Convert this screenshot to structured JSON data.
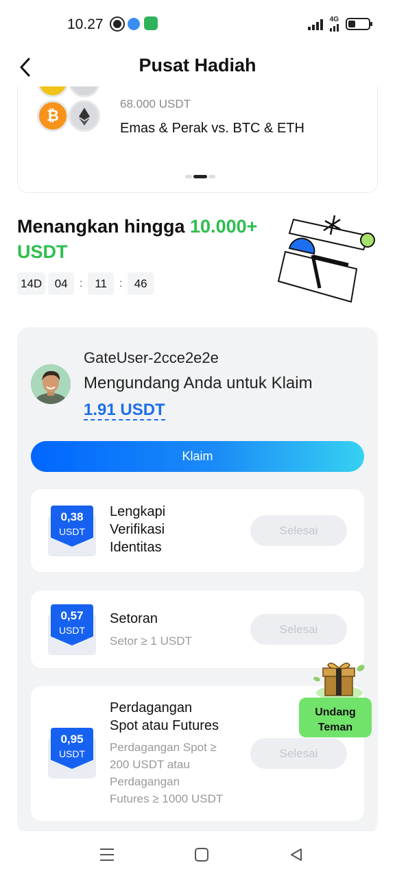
{
  "status_bar": {
    "time": "10.27",
    "network": "4G"
  },
  "header": {
    "title": "Pusat Hadiah"
  },
  "carousel": {
    "subtitle": "68.000 USDT",
    "title": "Emas & Perak vs. BTC & ETH"
  },
  "promo": {
    "headline_prefix": "Menangkan hingga ",
    "headline_amount": "10.000+",
    "headline_suffix": "USDT",
    "countdown": {
      "days": "14D",
      "hours": "04",
      "minutes": "11",
      "seconds": "46",
      "separator": ":"
    }
  },
  "invite": {
    "inviter_name": "GateUser-2cce2e2e",
    "message": "Mengundang Anda untuk Klaim",
    "amount": "1.91 USDT",
    "claim_label": "Klaim"
  },
  "tasks": [
    {
      "reward_value": "0,38",
      "reward_unit": "USDT",
      "title_lines": [
        "Lengkapi",
        "Verifikasi",
        "Identitas"
      ],
      "desc_lines": [],
      "status_label": "Selesai"
    },
    {
      "reward_value": "0,57",
      "reward_unit": "USDT",
      "title_lines": [
        "Setoran"
      ],
      "desc_lines": [
        "Setor ≥ 1 USDT"
      ],
      "status_label": "Selesai"
    },
    {
      "reward_value": "0,95",
      "reward_unit": "USDT",
      "title_lines": [
        "Perdagangan",
        "Spot atau Futures"
      ],
      "desc_lines": [
        "Perdagangan Spot ≥",
        "200 USDT atau",
        "Perdagangan",
        "Futures ≥ 1000 USDT"
      ],
      "status_label": "Selesai"
    }
  ],
  "floating_invite": {
    "line1": "Undang",
    "line2": "Teman"
  },
  "colors": {
    "accent_blue": "#1661f0",
    "highlight_green": "#2dbe4e",
    "invite_green": "#72e36a"
  }
}
